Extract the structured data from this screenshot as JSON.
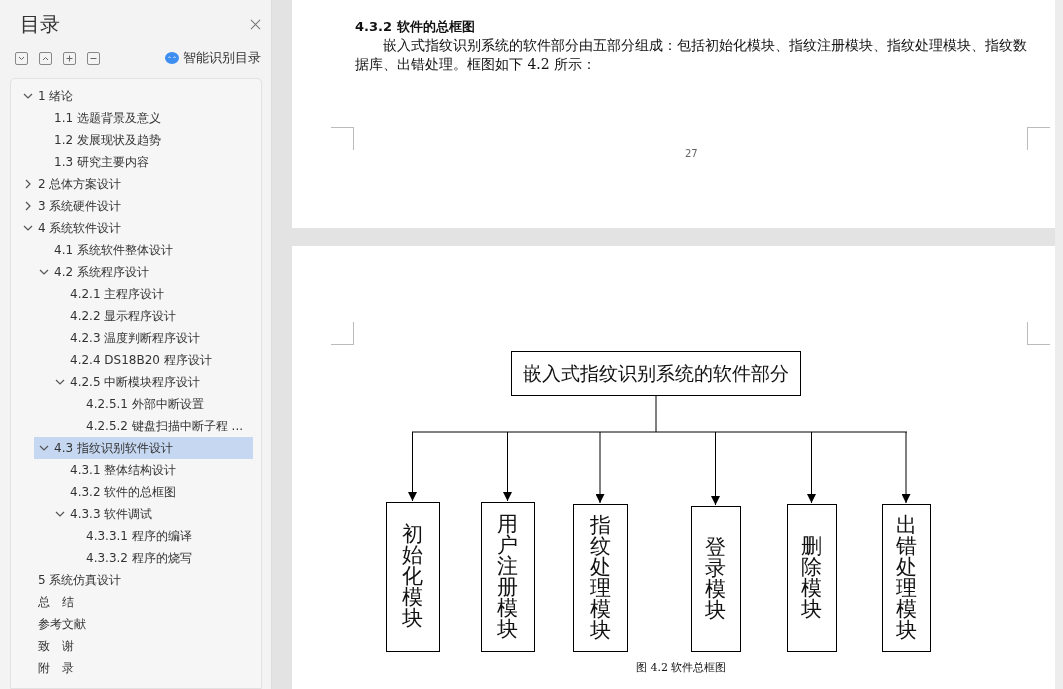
{
  "sidebar": {
    "title": "目录",
    "smart_button": "智能识别目录",
    "toc": [
      {
        "label": "1  绪论",
        "expanded": true,
        "selected": false,
        "children": [
          {
            "label": "1.1  选题背景及意义",
            "selected": false
          },
          {
            "label": "1.2  发展现状及趋势",
            "selected": false
          },
          {
            "label": "1.3  研究主要内容",
            "selected": false
          }
        ]
      },
      {
        "label": "2  总体方案设计",
        "expanded": false,
        "selected": false
      },
      {
        "label": "3  系统硬件设计",
        "expanded": false,
        "selected": false
      },
      {
        "label": "4  系统软件设计",
        "expanded": true,
        "selected": false,
        "children": [
          {
            "label": "4.1  系统软件整体设计",
            "selected": false
          },
          {
            "label": "4.2  系统程序设计",
            "expanded": true,
            "selected": false,
            "children": [
              {
                "label": "4.2.1  主程序设计",
                "selected": false
              },
              {
                "label": "4.2.2  显示程序设计",
                "selected": false
              },
              {
                "label": "4.2.3  温度判断程序设计",
                "selected": false
              },
              {
                "label": "4.2.4 DS18B20 程序设计",
                "selected": false
              },
              {
                "label": "4.2.5  中断模块程序设计",
                "expanded": true,
                "selected": false,
                "children": [
                  {
                    "label": "4.2.5.1  外部中断设置",
                    "selected": false
                  },
                  {
                    "label": "4.2.5.2  键盘扫描中断子程 ...",
                    "selected": false
                  }
                ]
              }
            ]
          },
          {
            "label": "4.3  指纹识别软件设计",
            "expanded": true,
            "selected": true,
            "children": [
              {
                "label": "4.3.1  整体结构设计",
                "selected": false
              },
              {
                "label": "4.3.2  软件的总框图",
                "selected": false
              },
              {
                "label": "4.3.3  软件调试",
                "expanded": true,
                "selected": false,
                "children": [
                  {
                    "label": "4.3.3.1 程序的编译",
                    "selected": false
                  },
                  {
                    "label": "4.3.3.2  程序的烧写",
                    "selected": false
                  }
                ]
              }
            ]
          }
        ]
      },
      {
        "label": "5  系统仿真设计",
        "selected": false
      },
      {
        "label": "总　结",
        "selected": false
      },
      {
        "label": "参考文献",
        "selected": false
      },
      {
        "label": "致　谢",
        "selected": false
      },
      {
        "label": "附　录",
        "selected": false
      }
    ]
  },
  "page_1": {
    "heading": "4.3.2  软件的总框图",
    "paragraph": "嵌入式指纹识别系统的软件部分由五部分组成：包括初始化模块、指纹注册模块、指纹处理模块、指纹数据库、出错处理。框图如下 4.2 所示：",
    "page_number": "27"
  },
  "page_2": {
    "diagram": {
      "root": "嵌入式指纹识别系统的软件部分",
      "modules": [
        "初始化模块",
        "用户注册模块",
        "指纹处理模块",
        "登录模块",
        "删除模块",
        "出错处理模块"
      ],
      "caption": "图 4.2 软件总框图"
    }
  }
}
